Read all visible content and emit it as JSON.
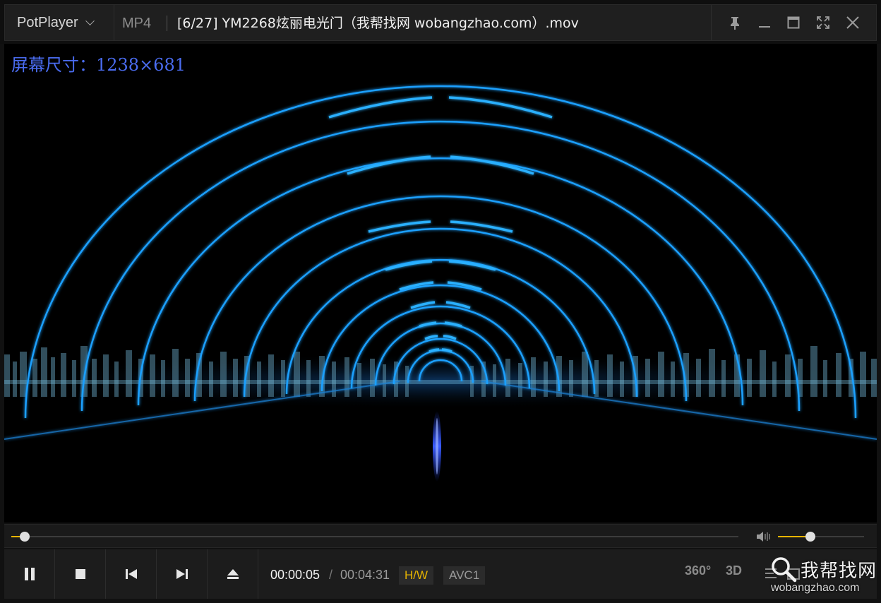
{
  "titlebar": {
    "brand": "PotPlayer",
    "format": "MP4",
    "file_title": "[6/27] YM2268炫丽电光门（我帮找网 wobangzhao.com）.mov",
    "icons": [
      "pin-icon",
      "minimize-icon",
      "maximize-icon",
      "fullscreen-icon",
      "close-icon"
    ]
  },
  "video": {
    "overlay_text": "屏幕尺寸：1238×681"
  },
  "seek": {
    "progress": 0.018,
    "volume": 0.38
  },
  "controls": {
    "current_time": "00:00:05",
    "separator": "/",
    "total_time": "00:04:31",
    "hw_badge": "H/W",
    "codec_badge": "AVC1",
    "mode_360": "360°",
    "mode_3d": "3D"
  },
  "watermark": {
    "cn": "我帮找网",
    "url": "wobangzhao.com"
  },
  "colors": {
    "accent": "#e8b400",
    "overlay": "#4a6cf0",
    "arc": "#1aa0ff"
  }
}
